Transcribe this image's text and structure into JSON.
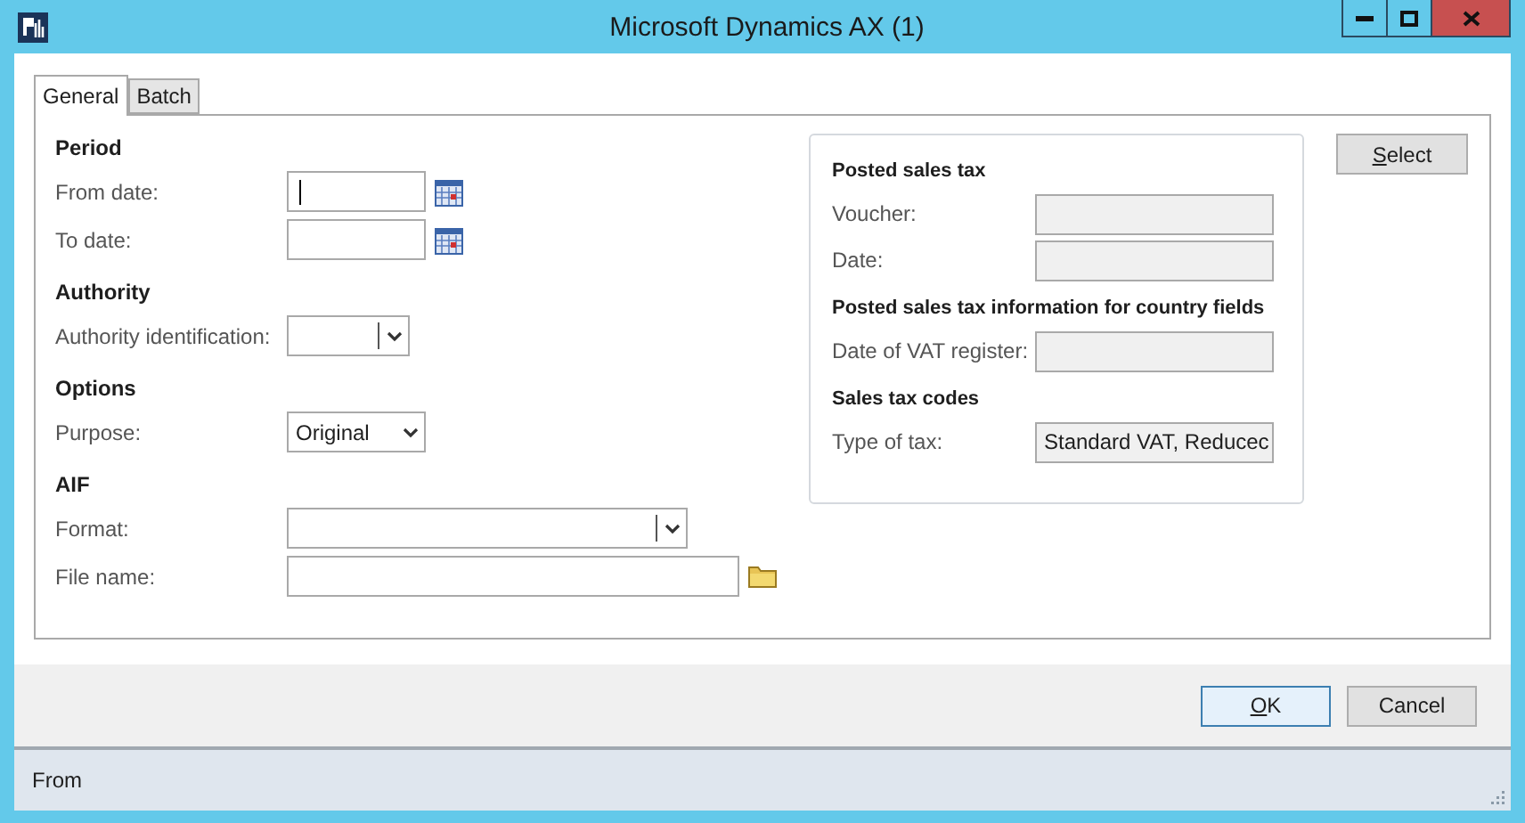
{
  "window": {
    "title": "Microsoft Dynamics AX (1)"
  },
  "tabs": [
    {
      "label": "General",
      "selected": true
    },
    {
      "label": "Batch",
      "selected": false
    }
  ],
  "left_sections": [
    {
      "heading": "Period",
      "fields": [
        {
          "label": "From date:",
          "kind": "date",
          "focused": true
        },
        {
          "label": "To date:",
          "kind": "date"
        }
      ]
    },
    {
      "heading": "Authority",
      "fields": [
        {
          "label": "Authority identification:",
          "kind": "combo_small"
        }
      ]
    },
    {
      "heading": "Options",
      "fields": [
        {
          "label": "Purpose:",
          "kind": "select",
          "value": "Original"
        }
      ]
    },
    {
      "heading": "AIF",
      "fields": [
        {
          "label": "Format:",
          "kind": "combo_wide"
        },
        {
          "label": "File name:",
          "kind": "file"
        }
      ]
    }
  ],
  "right_group": {
    "sections": [
      {
        "heading": "Posted sales tax",
        "fields": [
          {
            "label": "Voucher:"
          },
          {
            "label": "Date:"
          }
        ]
      },
      {
        "heading": "Posted sales tax information for country fields",
        "fields": [
          {
            "label": "Date of VAT register:"
          }
        ]
      },
      {
        "heading": "Sales tax codes",
        "fields": [
          {
            "label": "Type of tax:",
            "value": "Standard VAT, Reducec"
          }
        ]
      }
    ]
  },
  "side_buttons": [
    {
      "label": "Select",
      "access_key_underlined": true
    }
  ],
  "buttons": [
    {
      "label": "OK",
      "access_key_underlined": true,
      "default": true
    },
    {
      "label": "Cancel",
      "access_key_underlined": false,
      "default": false
    }
  ],
  "status_bar": {
    "text": "From"
  }
}
